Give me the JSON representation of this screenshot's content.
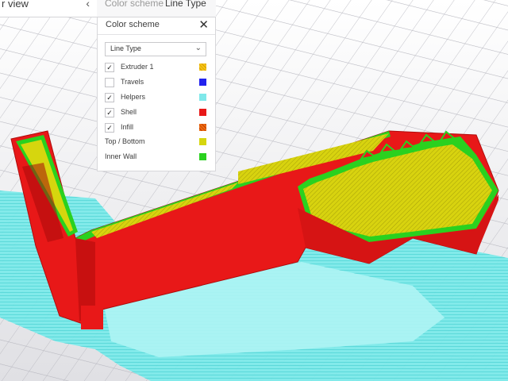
{
  "topbar": {
    "view_title": "r view",
    "collapse_icon": "chevron-left-icon",
    "scheme_label": "Color scheme",
    "scheme_value": "Line Type"
  },
  "panel": {
    "title": "Color scheme",
    "close_icon": "close-icon",
    "dropdown": {
      "selected": "Line Type",
      "arrow_icon": "chevron-down-icon"
    },
    "items": [
      {
        "label": "Extruder 1",
        "checked": true,
        "check_mark": "✓",
        "color": "#f5c518"
      },
      {
        "label": "Travels",
        "checked": false,
        "check_mark": "",
        "color": "#2222ee"
      },
      {
        "label": "Helpers",
        "checked": true,
        "check_mark": "✓",
        "color": "#7fe8ea"
      },
      {
        "label": "Shell",
        "checked": true,
        "check_mark": "✓",
        "color": "#e81818"
      },
      {
        "label": "Infill",
        "checked": true,
        "check_mark": "✓",
        "color": "#ee6d10"
      }
    ],
    "legend": [
      {
        "label": "Top / Bottom",
        "color": "#d6d60e"
      },
      {
        "label": "Inner Wall",
        "color": "#2ad11f"
      }
    ]
  }
}
